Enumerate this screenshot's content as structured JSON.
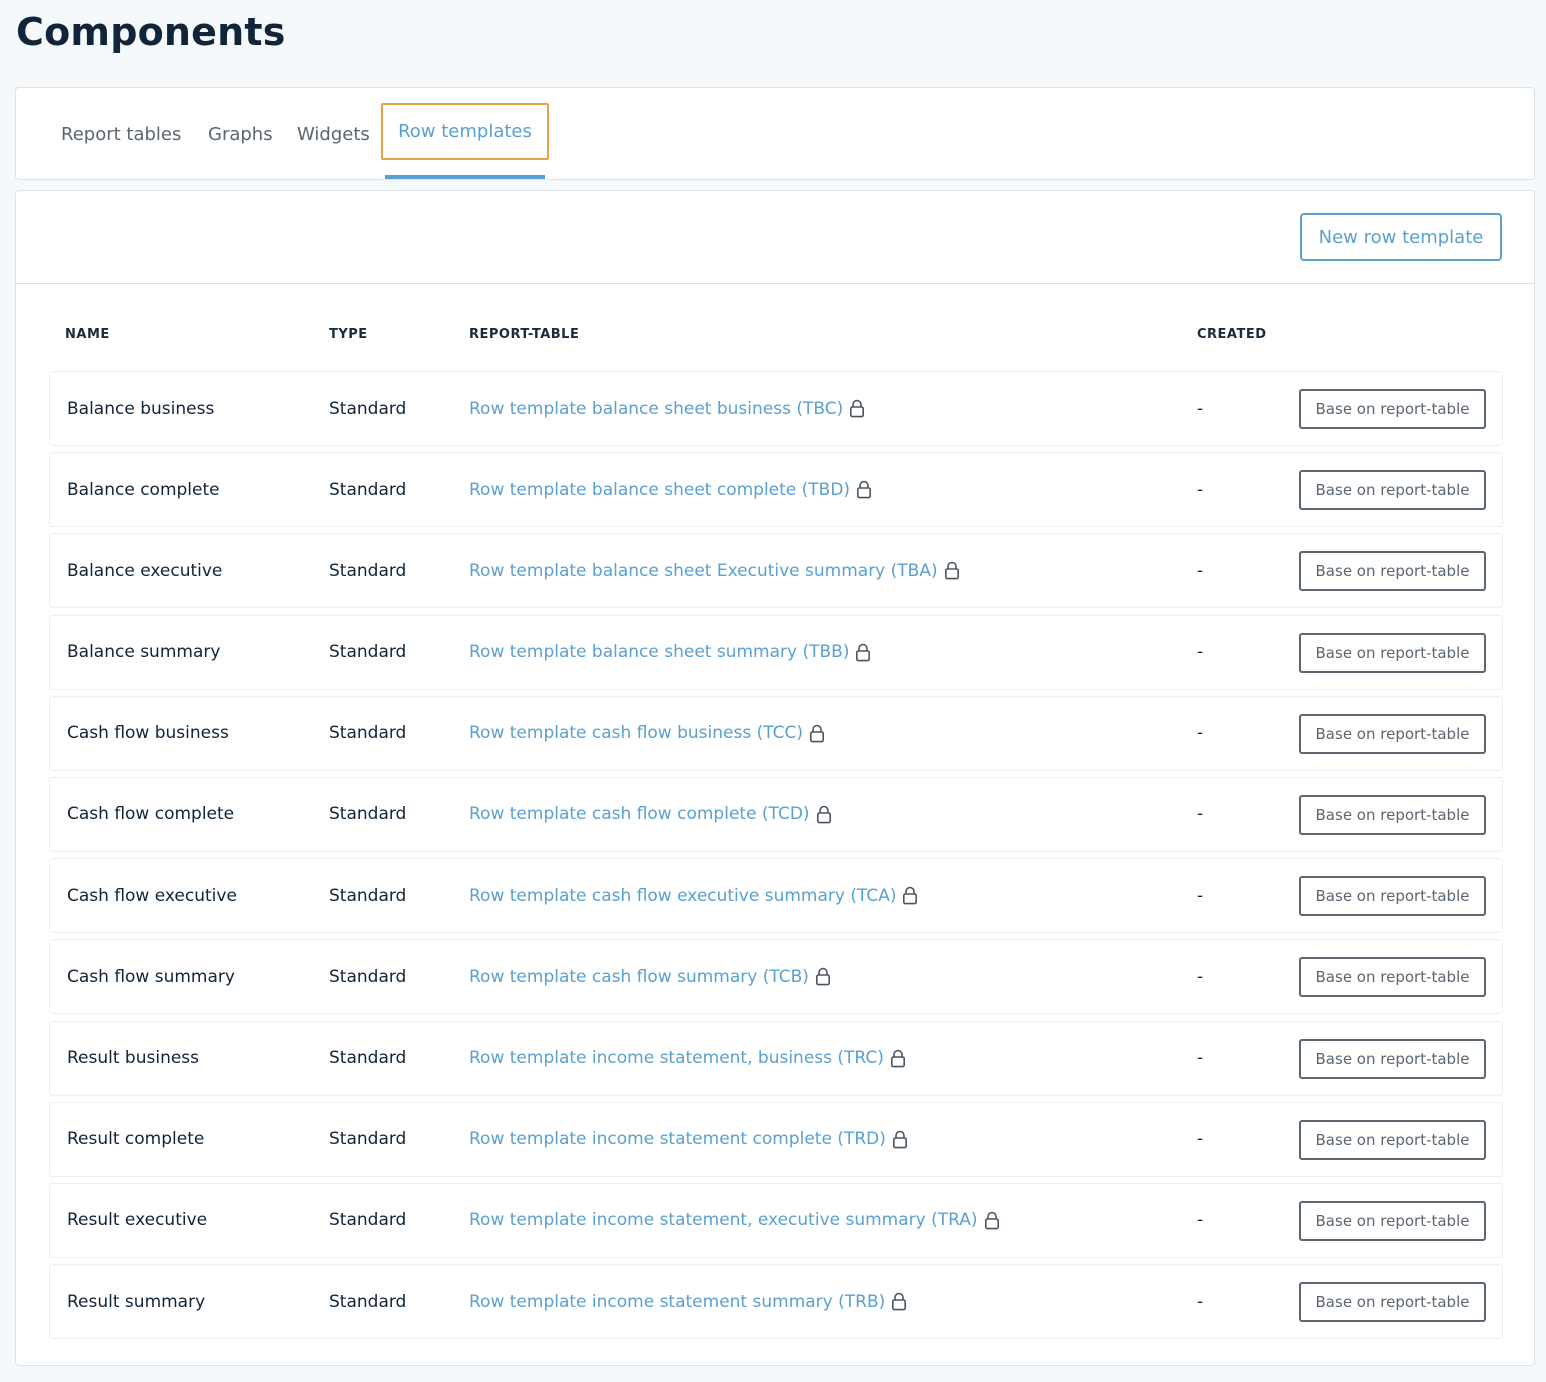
{
  "page": {
    "title": "Components"
  },
  "tabs": [
    {
      "label": "Report tables"
    },
    {
      "label": "Graphs"
    },
    {
      "label": "Widgets"
    },
    {
      "label": "Row templates"
    }
  ],
  "colors": {
    "accent": "#5aa0d0",
    "focus_outline": "#e9a04a",
    "text": "#10253a",
    "muted": "#5b6670"
  },
  "toolbar": {
    "new_button_label": "New row template"
  },
  "table": {
    "headers": {
      "name": "NAME",
      "type": "TYPE",
      "report_table": "REPORT-TABLE",
      "created": "CREATED"
    },
    "action_label": "Base on report-table",
    "lock_icon": "lock-icon",
    "rows": [
      {
        "name": "Balance business",
        "type": "Standard",
        "report_table": "Row template balance sheet business (TBC)",
        "created": "-"
      },
      {
        "name": "Balance complete",
        "type": "Standard",
        "report_table": "Row template balance sheet complete (TBD)",
        "created": "-"
      },
      {
        "name": "Balance executive",
        "type": "Standard",
        "report_table": "Row template balance sheet Executive summary (TBA)",
        "created": "-"
      },
      {
        "name": "Balance summary",
        "type": "Standard",
        "report_table": "Row template balance sheet summary (TBB)",
        "created": "-"
      },
      {
        "name": "Cash flow business",
        "type": "Standard",
        "report_table": "Row template cash flow business (TCC)",
        "created": "-"
      },
      {
        "name": "Cash flow complete",
        "type": "Standard",
        "report_table": "Row template cash flow complete (TCD)",
        "created": "-"
      },
      {
        "name": "Cash flow executive",
        "type": "Standard",
        "report_table": "Row template cash flow executive summary (TCA)",
        "created": "-"
      },
      {
        "name": "Cash flow summary",
        "type": "Standard",
        "report_table": "Row template cash flow summary (TCB)",
        "created": "-"
      },
      {
        "name": "Result business",
        "type": "Standard",
        "report_table": "Row template income statement, business (TRC)",
        "created": "-"
      },
      {
        "name": "Result complete",
        "type": "Standard",
        "report_table": "Row template income statement complete (TRD)",
        "created": "-"
      },
      {
        "name": "Result executive",
        "type": "Standard",
        "report_table": "Row template income statement, executive summary (TRA)",
        "created": "-"
      },
      {
        "name": "Result summary",
        "type": "Standard",
        "report_table": "Row template income statement summary (TRB)",
        "created": "-"
      }
    ]
  }
}
